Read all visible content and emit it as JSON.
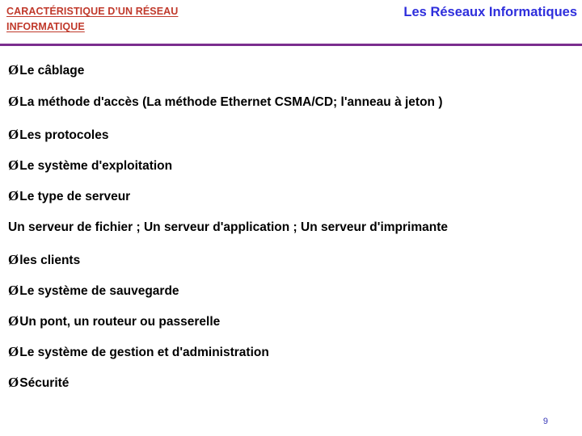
{
  "header": {
    "title_line1": "CARACTÉRISTIQUE D’UN RÉSEAU",
    "title_line2": "INFORMATIQUE",
    "right_title": "Les Réseaux Informatiques",
    "rule_color": "#7B2D8E",
    "left_color": "#C0392B",
    "right_color": "#2E2EDC"
  },
  "bullet_glyph": "Ø",
  "items": [
    {
      "text": "Le câblage"
    },
    {
      "text": "La méthode d'accès (La méthode Ethernet CSMA/CD; l'anneau à jeton )"
    },
    {
      "text": "Les protocoles"
    },
    {
      "text": "Le système d'exploitation"
    },
    {
      "text": "Le type de serveur"
    },
    {
      "text": "les clients"
    },
    {
      "text": "Le système de  sauvegarde"
    },
    {
      "text": "Un pont, un routeur ou passerelle"
    },
    {
      "text": "Le système de gestion et d'administration"
    },
    {
      "text": "Sécurité"
    }
  ],
  "paragraph": "Un serveur de fichier ; Un serveur d'application ; Un serveur d'imprimante",
  "page_number": "9"
}
